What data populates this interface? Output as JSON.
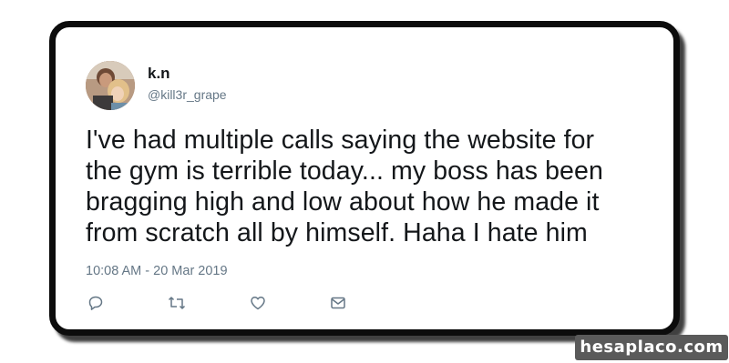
{
  "tweet": {
    "display_name": "k.n",
    "handle": "@kill3r_grape",
    "text": "I've had multiple calls saying the website for\nthe gym is terrible today... my boss has been\nbragging high and low about how he made it\nfrom scratch all by himself. Haha I hate him",
    "timestamp": "10:08 AM - 20 Mar 2019",
    "actions": {
      "reply": "reply-icon",
      "retweet": "retweet-icon",
      "like": "heart-icon",
      "message": "envelope-icon"
    }
  },
  "colors": {
    "text": "#14171a",
    "secondary": "#657786",
    "card_border": "#0c0c0c"
  },
  "watermark": {
    "text": "hesaplaco.com"
  }
}
